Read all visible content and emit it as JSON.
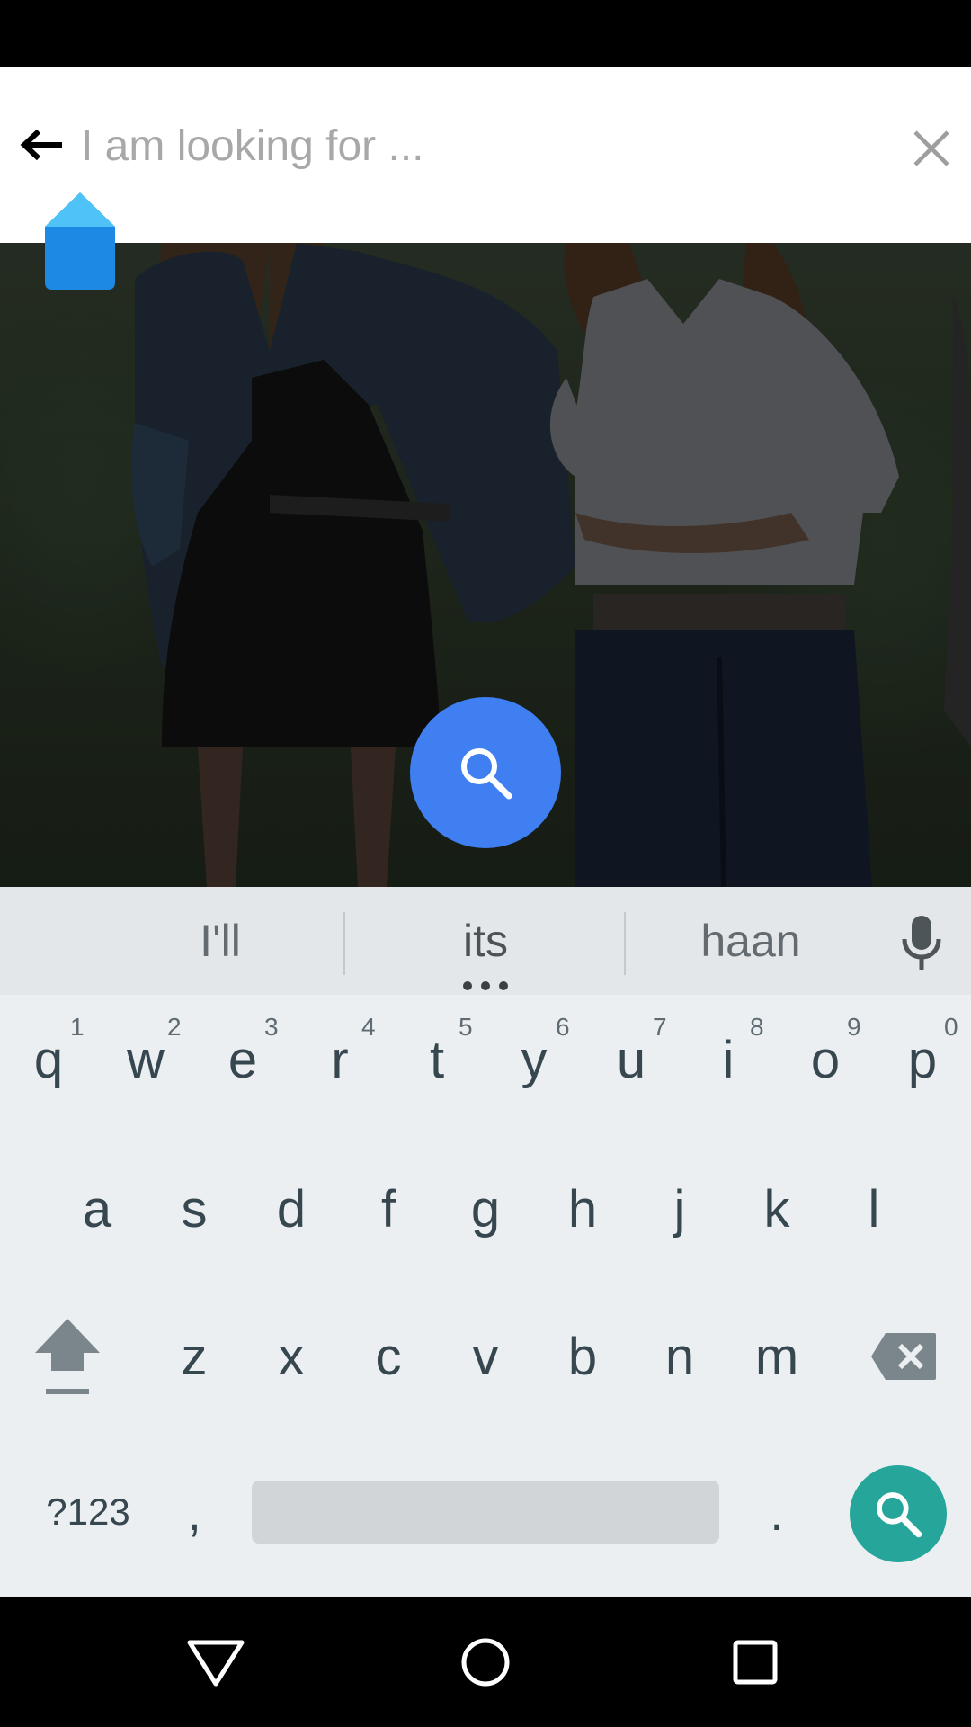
{
  "search": {
    "placeholder": "I am looking for ..."
  },
  "suggestions": [
    "I'll",
    "its",
    "haan"
  ],
  "keyboard": {
    "row1": [
      {
        "letter": "q",
        "hint": "1"
      },
      {
        "letter": "w",
        "hint": "2"
      },
      {
        "letter": "e",
        "hint": "3"
      },
      {
        "letter": "r",
        "hint": "4"
      },
      {
        "letter": "t",
        "hint": "5"
      },
      {
        "letter": "y",
        "hint": "6"
      },
      {
        "letter": "u",
        "hint": "7"
      },
      {
        "letter": "i",
        "hint": "8"
      },
      {
        "letter": "o",
        "hint": "9"
      },
      {
        "letter": "p",
        "hint": "0"
      }
    ],
    "row2": [
      "a",
      "s",
      "d",
      "f",
      "g",
      "h",
      "j",
      "k",
      "l"
    ],
    "row3": [
      "z",
      "x",
      "c",
      "v",
      "b",
      "n",
      "m"
    ],
    "symbols_label": "?123",
    "comma": ",",
    "period": "."
  },
  "icons": {
    "back": "arrow-left-icon",
    "clear": "close-icon",
    "search": "search-icon",
    "mic": "microphone-icon",
    "shift": "shift-icon",
    "backspace": "backspace-icon",
    "nav_back": "nav-back-icon",
    "nav_home": "nav-home-icon",
    "nav_recents": "nav-recents-icon"
  },
  "colors": {
    "fab": "#3f7ff2",
    "enter": "#26a69a",
    "cursor_handle": "#1e88e5",
    "keyboard_bg": "#eceff1"
  }
}
